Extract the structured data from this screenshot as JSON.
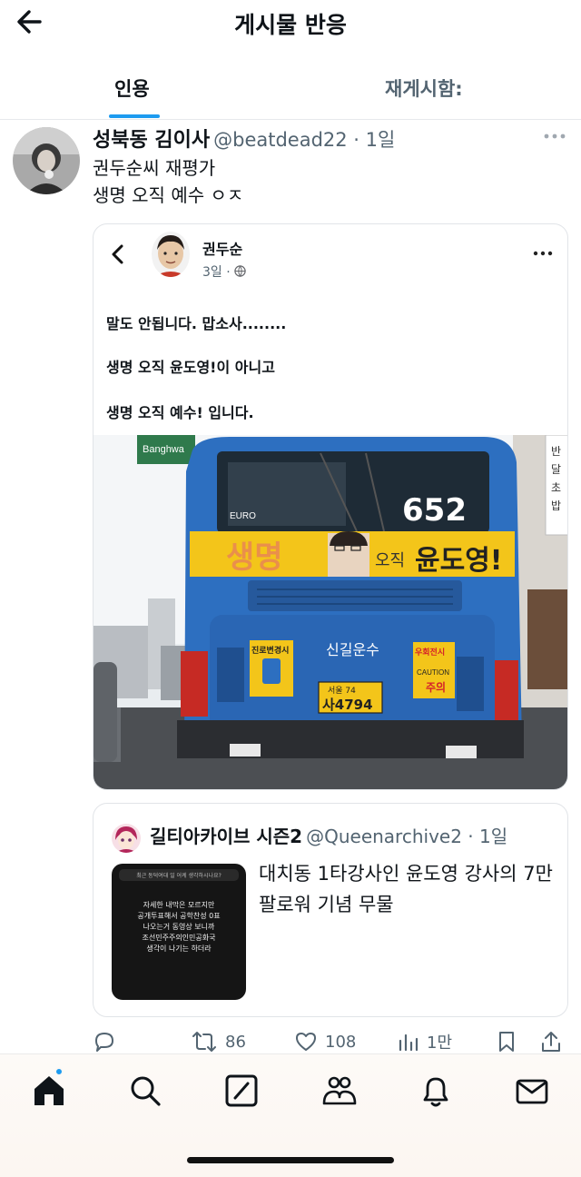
{
  "header": {
    "title": "게시물 반응",
    "back_icon": "arrow-left-icon"
  },
  "tabs": [
    {
      "label": "인용",
      "active": true
    },
    {
      "label": "재게시함:",
      "active": false
    }
  ],
  "post": {
    "author_name": "성북동 김이사",
    "handle_time": "@beatdead22 · 1일",
    "text_lines": [
      "권두순씨 재평가",
      "생명 오직 예수 ㅇㅈ"
    ],
    "embedded": {
      "author": "권두순",
      "time": "3일 ·",
      "lines": [
        "말도 안됩니다. 맙소사........",
        "생명 오직 윤도영!이 아니고",
        "생명 오직 예수! 입니다."
      ],
      "photo": {
        "street_sign": "Banghwa",
        "bus_number": "652",
        "banner_big": "생명",
        "banner_small": "오직",
        "banner_name": "윤도영!",
        "company": "신길운수",
        "plate_top": "서울 74",
        "plate_bottom": "사4794",
        "sticker_left": "진로변경시",
        "sticker_right_top": "우회전시",
        "sticker_right_bottom": "주의",
        "sticker_caution": "CAUTION",
        "side_sign": "반 달 초 밥",
        "destination_tag": "EURO"
      }
    },
    "quoted": {
      "author_name": "길티아카이브 시즌2",
      "handle_time": "@Queenarchive2 · 1일",
      "thumb_question": "최근 동덕여대 일 어케 생각하시나요?",
      "thumb_lines": [
        "자세한 내막은 모르지만",
        "공개투표해서 공학찬성 0표",
        "나오는거 동영상 보니까",
        "조선민주주의인민공화국",
        "생각이 나기는 하더라"
      ],
      "text": "대치동 1타강사인 윤도영 강사의 7만 팔로워 기념 무물"
    },
    "actions": {
      "reply_count": "",
      "repost_count": "86",
      "like_count": "108",
      "views_count": "1만"
    }
  },
  "bottom_nav": [
    "home-icon",
    "search-icon",
    "grok-icon",
    "communities-icon",
    "notifications-icon",
    "messages-icon"
  ],
  "colors": {
    "accent": "#1d9bf0",
    "text": "#0f1419",
    "muted": "#536471",
    "bus_blue": "#2d6fc0",
    "banner_yellow": "#f3c51a"
  }
}
